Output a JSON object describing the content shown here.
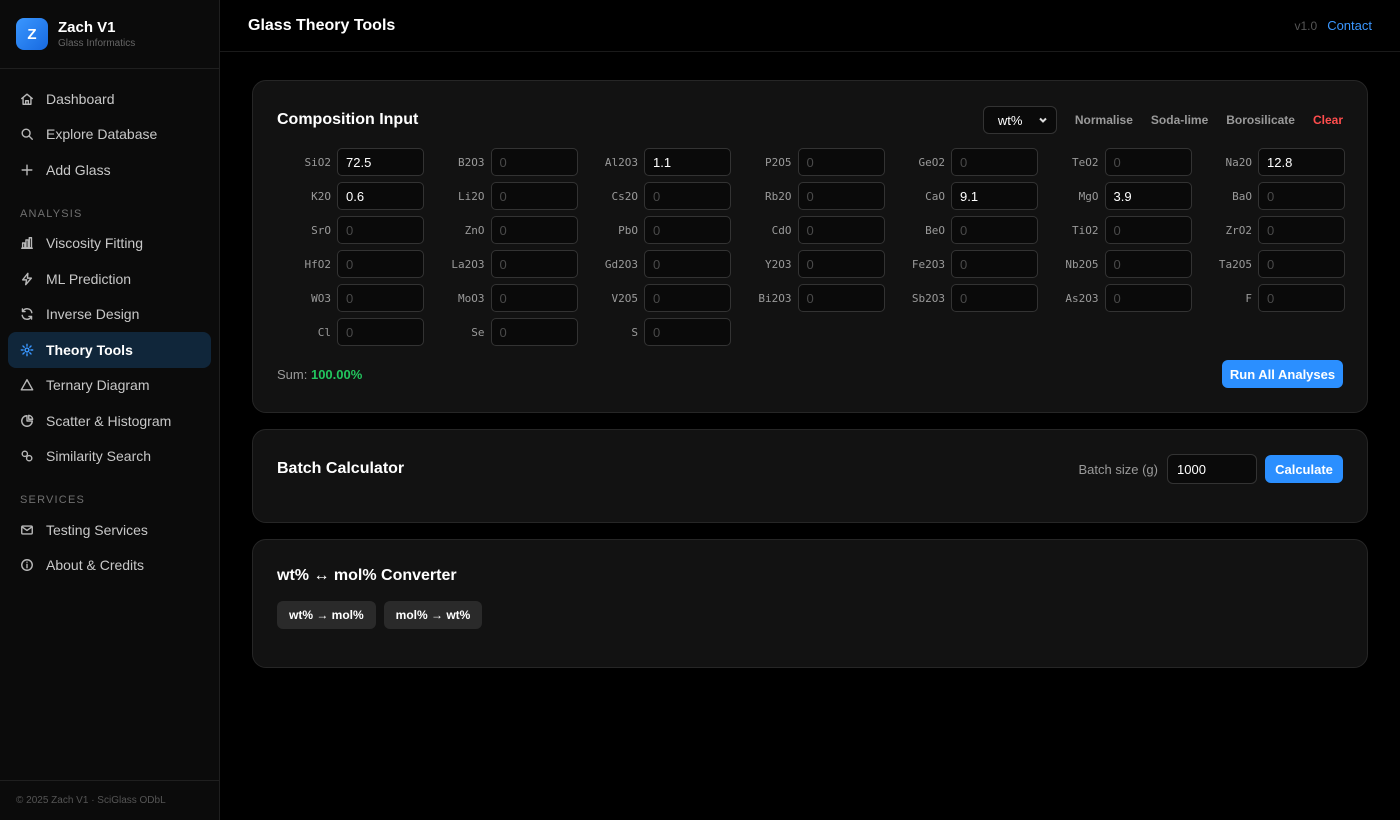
{
  "brand": {
    "logo_letter": "Z",
    "name": "Zach V1",
    "subtitle": "Glass Informatics"
  },
  "nav": {
    "main": [
      {
        "label": "Dashboard",
        "icon": "home-icon"
      },
      {
        "label": "Explore Database",
        "icon": "search-icon"
      },
      {
        "label": "Add Glass",
        "icon": "plus-icon"
      }
    ],
    "analysis_heading": "ANALYSIS",
    "analysis": [
      {
        "label": "Viscosity Fitting",
        "icon": "bar-chart-icon"
      },
      {
        "label": "ML Prediction",
        "icon": "lightning-icon"
      },
      {
        "label": "Inverse Design",
        "icon": "refresh-icon"
      },
      {
        "label": "Theory Tools",
        "icon": "gear-icon",
        "active": true
      },
      {
        "label": "Ternary Diagram",
        "icon": "triangle-icon"
      },
      {
        "label": "Scatter & Histogram",
        "icon": "pie-chart-icon"
      },
      {
        "label": "Similarity Search",
        "icon": "circles-icon"
      }
    ],
    "services_heading": "SERVICES",
    "services": [
      {
        "label": "Testing Services",
        "icon": "mail-icon"
      },
      {
        "label": "About & Credits",
        "icon": "info-icon"
      }
    ]
  },
  "footer": "© 2025 Zach V1 · SciGlass ODbL",
  "header": {
    "title": "Glass Theory Tools",
    "version": "v1.0",
    "contact": "Contact"
  },
  "composition": {
    "title": "Composition Input",
    "unit": "wt%",
    "actions": {
      "normalise": "Normalise",
      "soda_lime": "Soda-lime",
      "borosilicate": "Borosilicate",
      "clear": "Clear"
    },
    "placeholder": "0",
    "oxides": [
      {
        "label": "SiO2",
        "value": "72.5"
      },
      {
        "label": "B2O3",
        "value": ""
      },
      {
        "label": "Al2O3",
        "value": "1.1"
      },
      {
        "label": "P2O5",
        "value": ""
      },
      {
        "label": "GeO2",
        "value": ""
      },
      {
        "label": "TeO2",
        "value": ""
      },
      {
        "label": "Na2O",
        "value": "12.8"
      },
      {
        "label": "K2O",
        "value": "0.6"
      },
      {
        "label": "Li2O",
        "value": ""
      },
      {
        "label": "Cs2O",
        "value": ""
      },
      {
        "label": "Rb2O",
        "value": ""
      },
      {
        "label": "CaO",
        "value": "9.1"
      },
      {
        "label": "MgO",
        "value": "3.9"
      },
      {
        "label": "BaO",
        "value": ""
      },
      {
        "label": "SrO",
        "value": ""
      },
      {
        "label": "ZnO",
        "value": ""
      },
      {
        "label": "PbO",
        "value": ""
      },
      {
        "label": "CdO",
        "value": ""
      },
      {
        "label": "BeO",
        "value": ""
      },
      {
        "label": "TiO2",
        "value": ""
      },
      {
        "label": "ZrO2",
        "value": ""
      },
      {
        "label": "HfO2",
        "value": ""
      },
      {
        "label": "La2O3",
        "value": ""
      },
      {
        "label": "Gd2O3",
        "value": ""
      },
      {
        "label": "Y2O3",
        "value": ""
      },
      {
        "label": "Fe2O3",
        "value": ""
      },
      {
        "label": "Nb2O5",
        "value": ""
      },
      {
        "label": "Ta2O5",
        "value": ""
      },
      {
        "label": "WO3",
        "value": ""
      },
      {
        "label": "MoO3",
        "value": ""
      },
      {
        "label": "V2O5",
        "value": ""
      },
      {
        "label": "Bi2O3",
        "value": ""
      },
      {
        "label": "Sb2O3",
        "value": ""
      },
      {
        "label": "As2O3",
        "value": ""
      },
      {
        "label": "F",
        "value": ""
      },
      {
        "label": "Cl",
        "value": ""
      },
      {
        "label": "Se",
        "value": ""
      },
      {
        "label": "S",
        "value": ""
      }
    ],
    "sum_label": "Sum:",
    "sum_value": "100.00%",
    "run_label": "Run All Analyses"
  },
  "batch": {
    "title": "Batch Calculator",
    "size_label": "Batch size (g)",
    "size_value": "1000",
    "calculate_label": "Calculate"
  },
  "converter": {
    "title": "wt% ↔ mol% Converter",
    "to_mol": "wt% → mol%",
    "to_wt": "mol% → wt%"
  },
  "colors": {
    "accent": "#2b8fff",
    "sum_ok": "#22c55e",
    "danger": "#ff4d4d",
    "active_nav_bg": "#10263a"
  }
}
